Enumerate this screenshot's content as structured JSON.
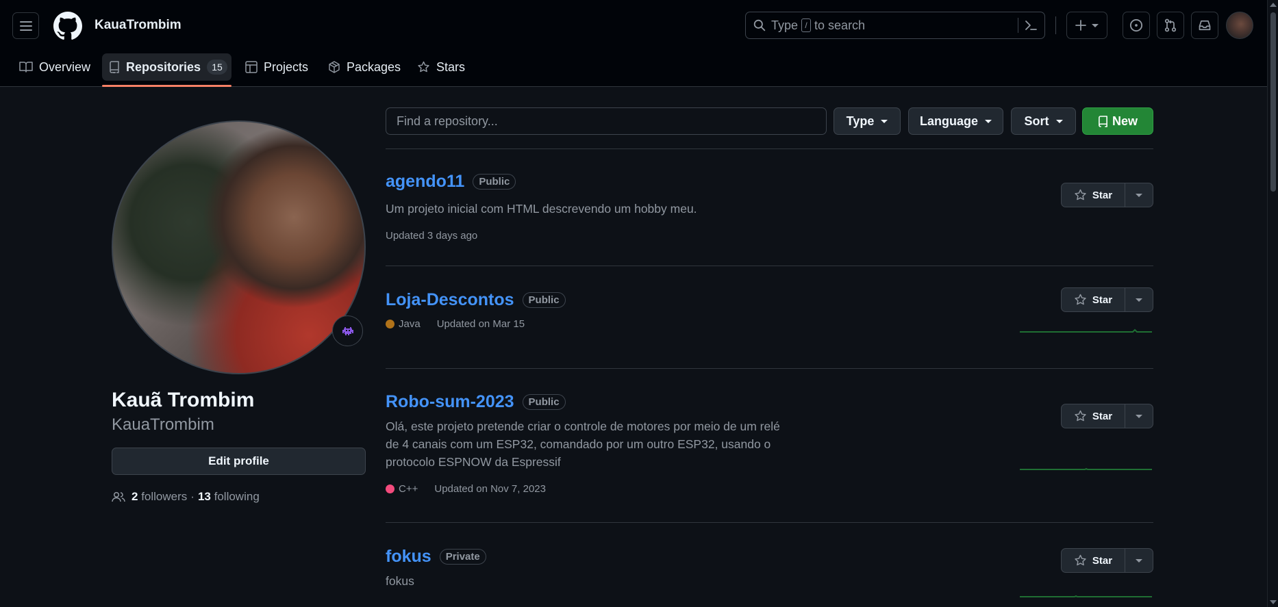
{
  "header": {
    "owner_name": "KauaTrombim",
    "search": {
      "before": "Type",
      "key": "/",
      "after": "to search"
    }
  },
  "tabs": [
    {
      "label": "Overview"
    },
    {
      "label": "Repositories",
      "count": "15"
    },
    {
      "label": "Projects"
    },
    {
      "label": "Packages"
    },
    {
      "label": "Stars"
    }
  ],
  "profile": {
    "full_name": "Kauã Trombim",
    "login": "KauaTrombim",
    "edit_label": "Edit profile",
    "followers_count": "2",
    "followers_label": "followers",
    "separator": "·",
    "following_count": "13",
    "following_label": "following"
  },
  "filters": {
    "placeholder": "Find a repository...",
    "type_label": "Type",
    "language_label": "Language",
    "sort_label": "Sort",
    "new_label": "New"
  },
  "repos": [
    {
      "name": "agendo11",
      "visibility": "Public",
      "description": "Um projeto inicial com HTML descrevendo um hobby meu.",
      "language": "",
      "updated": "Updated 3 days ago",
      "star_label": "Star"
    },
    {
      "name": "Loja-Descontos",
      "visibility": "Public",
      "description": "",
      "language": "Java",
      "language_color": "#b07219",
      "updated": "Updated on Mar 15",
      "star_label": "Star"
    },
    {
      "name": "Robo-sum-2023",
      "visibility": "Public",
      "description": "Olá, este projeto pretende criar o controle de motores por meio de um relé de 4 canais com um ESP32, comandado por um outro ESP32, usando o protocolo ESPNOW da Espressif",
      "language": "C++",
      "language_color": "#f34b7d",
      "updated": "Updated on Nov 7, 2023",
      "star_label": "Star"
    },
    {
      "name": "fokus",
      "visibility": "Private",
      "description": "fokus",
      "star_label": "Star"
    }
  ],
  "colors": {
    "accent_link": "#4493f8",
    "tab_underline": "#f78166",
    "new_button": "#238636",
    "sparkline": "#1f6f33"
  }
}
